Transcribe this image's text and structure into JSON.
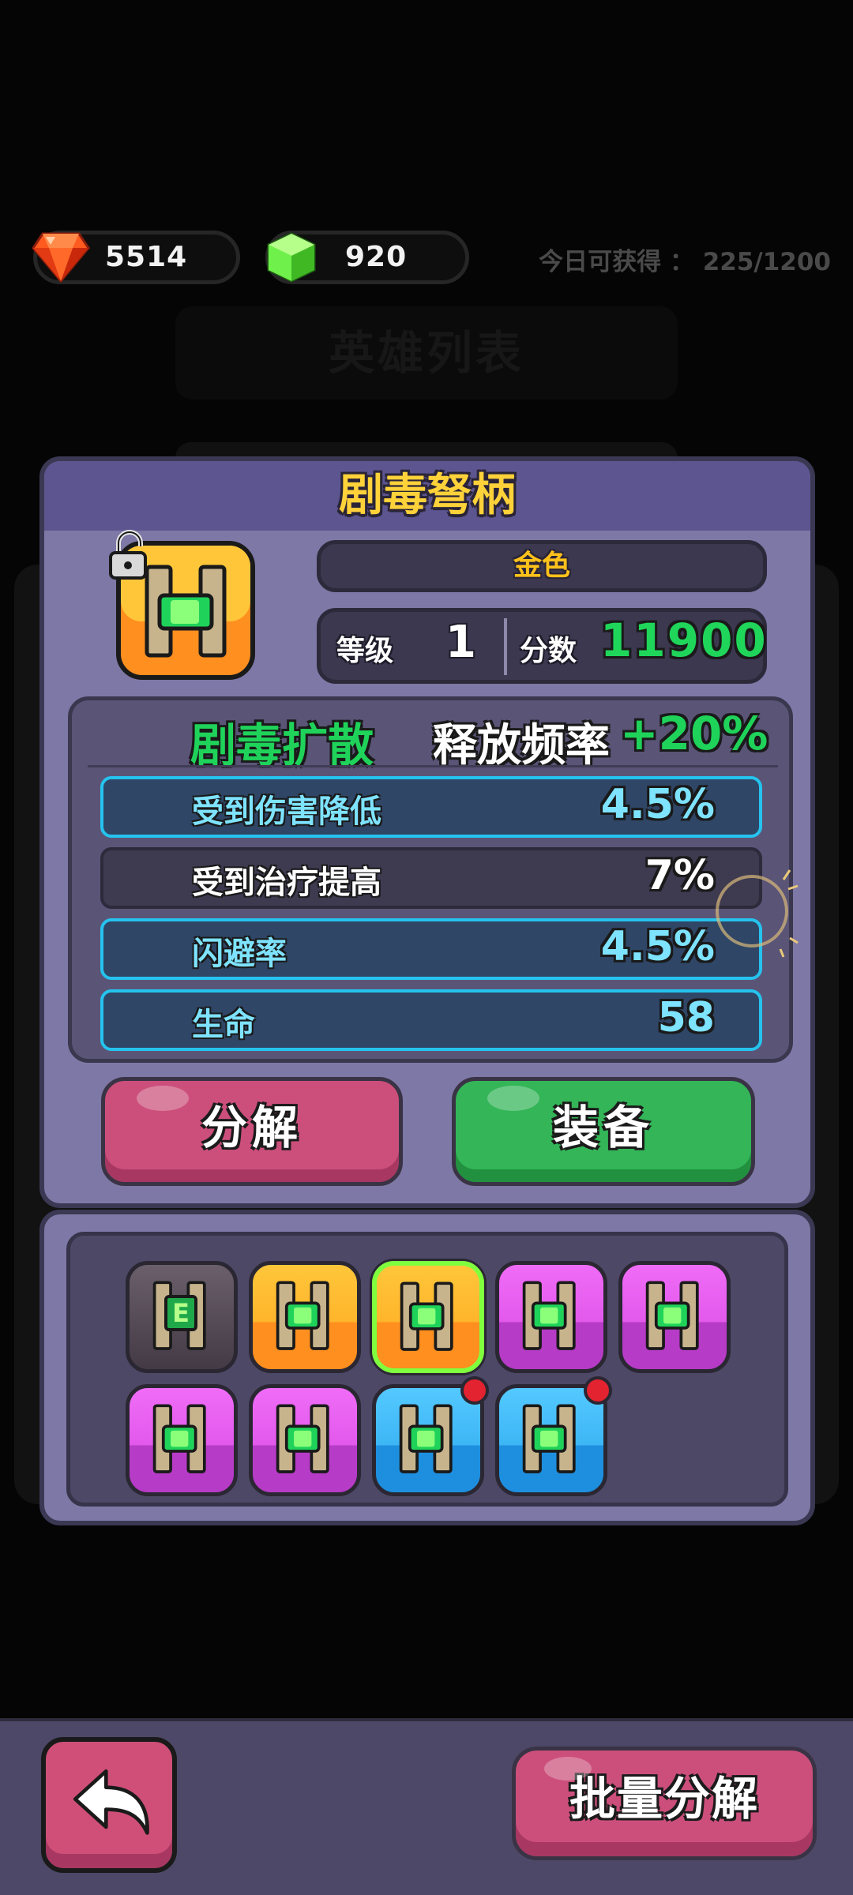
{
  "currencies": {
    "gems": {
      "value": "5514",
      "icon": "red-gem-icon"
    },
    "cubes": {
      "value": "920",
      "icon": "green-cube-icon"
    }
  },
  "daily": {
    "label": "今日可获得",
    "separator": "：",
    "value": "225/1200"
  },
  "background": {
    "ghost_title": "英雄列表"
  },
  "item": {
    "name": "剧毒弩柄",
    "quality": "金色",
    "level_label": "等级",
    "level": "1",
    "score_label": "分数",
    "score": "11900",
    "skill": {
      "name": "剧毒扩散",
      "attr": "释放频率",
      "bonus": "+20%"
    },
    "stats": [
      {
        "name": "受到伤害降低",
        "value": "4.5%",
        "style": "blue"
      },
      {
        "name": "受到治疗提高",
        "value": "7%",
        "style": "dark"
      },
      {
        "name": "闪避率",
        "value": "4.5%",
        "style": "blue"
      },
      {
        "name": "生命",
        "value": "58",
        "style": "blue"
      }
    ]
  },
  "actions": {
    "decompose": "分解",
    "equip": "装备"
  },
  "inventory": {
    "slots": [
      {
        "rarity": "grey",
        "mark": "E",
        "selected": false,
        "badge": false
      },
      {
        "rarity": "orange",
        "mark": "",
        "selected": false,
        "badge": false
      },
      {
        "rarity": "orange",
        "mark": "",
        "selected": true,
        "badge": false
      },
      {
        "rarity": "purple",
        "mark": "",
        "selected": false,
        "badge": false
      },
      {
        "rarity": "purple",
        "mark": "",
        "selected": false,
        "badge": false
      },
      {
        "rarity": "purple",
        "mark": "",
        "selected": false,
        "badge": false
      },
      {
        "rarity": "purple",
        "mark": "",
        "selected": false,
        "badge": false
      },
      {
        "rarity": "blue",
        "mark": "",
        "selected": false,
        "badge": true
      },
      {
        "rarity": "blue",
        "mark": "",
        "selected": false,
        "badge": true
      }
    ]
  },
  "footer": {
    "back_icon": "back-arrow-icon",
    "batch_decompose": "批量分解"
  },
  "colors": {
    "gold": "#ffd23a",
    "green": "#1fd35a",
    "stat_blue": "#7ee3ff",
    "panel": "#7d78a6",
    "header": "#5c5590",
    "pink_button": "#cc4f7b",
    "green_button": "#33b558"
  }
}
